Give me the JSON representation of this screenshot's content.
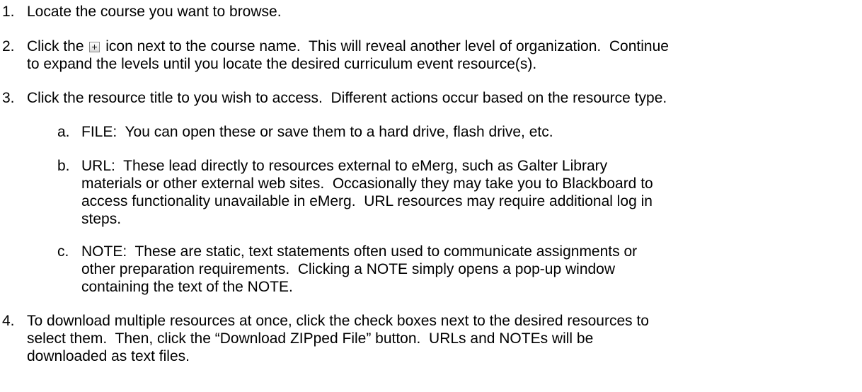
{
  "steps": [
    {
      "number": "1.",
      "text": "Locate the course you want to browse."
    },
    {
      "number": "2.",
      "text_before_icon": "Click the",
      "icon": "expand-plus-icon",
      "text_after_icon_line1": "icon next to the course name.  This will reveal another level of organization.  Continue",
      "text_line2": "to expand the levels until you locate the desired curriculum event resource(s)."
    },
    {
      "number": "3.",
      "text": "Click the resource title to you wish to access.  Different actions occur based on the resource type.",
      "substeps": [
        {
          "letter": "a.",
          "lines": [
            "FILE:  You can open these or save them to a hard drive, flash drive, etc."
          ]
        },
        {
          "letter": "b.",
          "lines": [
            "URL:  These lead directly to resources external to eMerg, such as Galter Library",
            "materials or other external web sites.  Occasionally they may take you to Blackboard to",
            "access functionality unavailable in eMerg.  URL resources may require additional log in",
            "steps."
          ]
        },
        {
          "letter": "c.",
          "lines": [
            "NOTE:  These are static, text statements often used to communicate assignments or",
            "other preparation requirements.  Clicking a NOTE simply opens a pop-up window",
            "containing the text of the NOTE."
          ]
        }
      ]
    },
    {
      "number": "4.",
      "lines": [
        "To download multiple resources at once, click the check boxes next to the desired resources to",
        "select them.  Then, click the “Download ZIPped File” button.  URLs and NOTEs will be",
        "downloaded as text files."
      ]
    }
  ]
}
